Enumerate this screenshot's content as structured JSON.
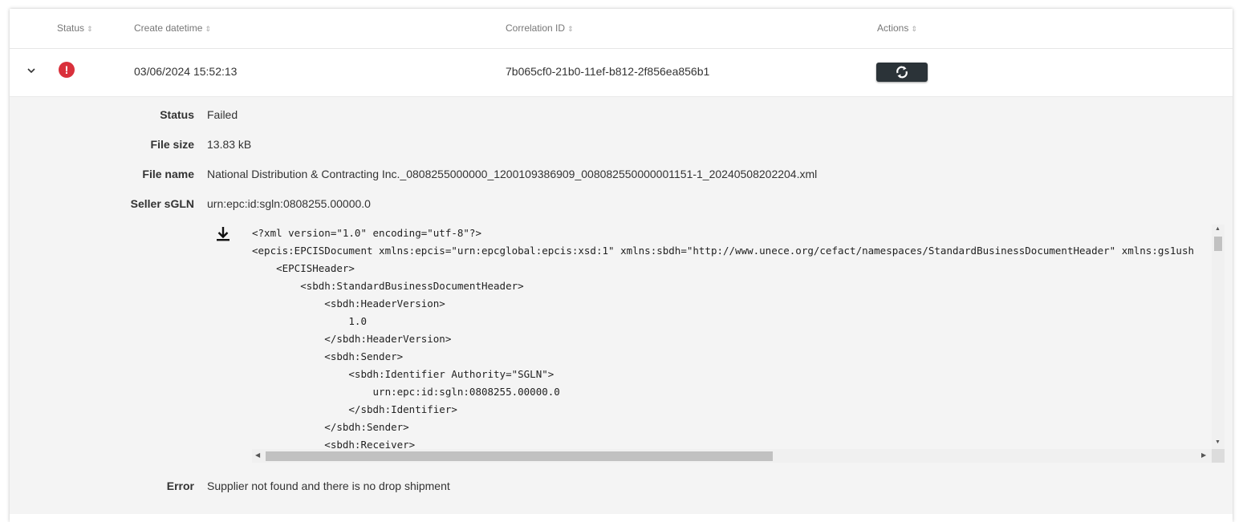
{
  "table": {
    "columns": {
      "status": "Status",
      "create_datetime": "Create datetime",
      "correlation_id": "Correlation ID",
      "actions": "Actions"
    },
    "sort_glyph": "⇕"
  },
  "row": {
    "status_icon": "error-icon",
    "status_glyph": "!",
    "create_datetime": "03/06/2024 15:52:13",
    "correlation_id": "7b065cf0-21b0-11ef-b812-2f856ea856b1",
    "action_icon": "refresh-icon"
  },
  "details": {
    "status_label": "Status",
    "status_value": "Failed",
    "file_size_label": "File size",
    "file_size_value": "13.83 kB",
    "file_name_label": "File name",
    "file_name_value": "National Distribution & Contracting Inc._0808255000000_1200109386909_008082550000001151-1_20240508202204.xml",
    "seller_sgln_label": "Seller sGLN",
    "seller_sgln_value": "urn:epc:id:sgln:0808255.00000.0",
    "download_icon": "download-icon",
    "error_label": "Error",
    "error_value": "Supplier not found and there is no drop shipment"
  },
  "xml_lines": [
    "<?xml version=\"1.0\" encoding=\"utf-8\"?>",
    "<epcis:EPCISDocument xmlns:epcis=\"urn:epcglobal:epcis:xsd:1\" xmlns:sbdh=\"http://www.unece.org/cefact/namespaces/StandardBusinessDocumentHeader\" xmlns:gs1ush",
    "    <EPCISHeader>",
    "        <sbdh:StandardBusinessDocumentHeader>",
    "            <sbdh:HeaderVersion>",
    "                1.0",
    "            </sbdh:HeaderVersion>",
    "            <sbdh:Sender>",
    "                <sbdh:Identifier Authority=\"SGLN\">",
    "                    urn:epc:id:sgln:0808255.00000.0",
    "                </sbdh:Identifier>",
    "            </sbdh:Sender>",
    "            <sbdh:Receiver>"
  ],
  "colors": {
    "error": "#d9303b",
    "button": "#2b3338",
    "detail_bg": "#f4f4f4"
  }
}
